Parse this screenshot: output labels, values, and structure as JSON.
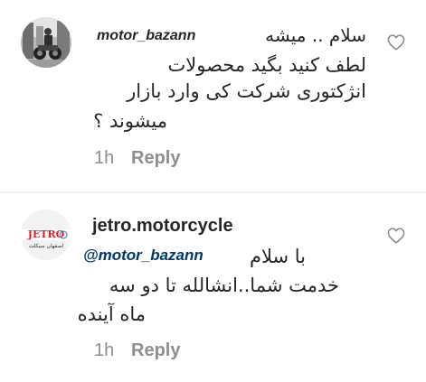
{
  "comments": [
    {
      "username": "motor_bazann",
      "text_lines": [
        "سلام .. میشه",
        "لطف کنید بگید محصولات",
        "انژکتوری شرکت کی وارد بازار",
        "میشوند ؟"
      ],
      "time": "1h",
      "reply_label": "Reply"
    },
    {
      "username": "jetro.motorcycle",
      "mention": "@motor_bazann",
      "text_lines": [
        "با سلام",
        "خدمت شما..انشالله تا دو سه",
        "ماه آینده"
      ],
      "avatar_logo_text": "JETRO",
      "avatar_subtext": "اصفهان سیکلت",
      "time": "1h",
      "reply_label": "Reply"
    }
  ],
  "icons": {
    "like": "heart-outline-icon"
  },
  "colors": {
    "text": "#262626",
    "muted": "#8e8e8e",
    "mention": "#00376b",
    "divider": "#eeeeee",
    "jetro_red": "#d2232a"
  }
}
